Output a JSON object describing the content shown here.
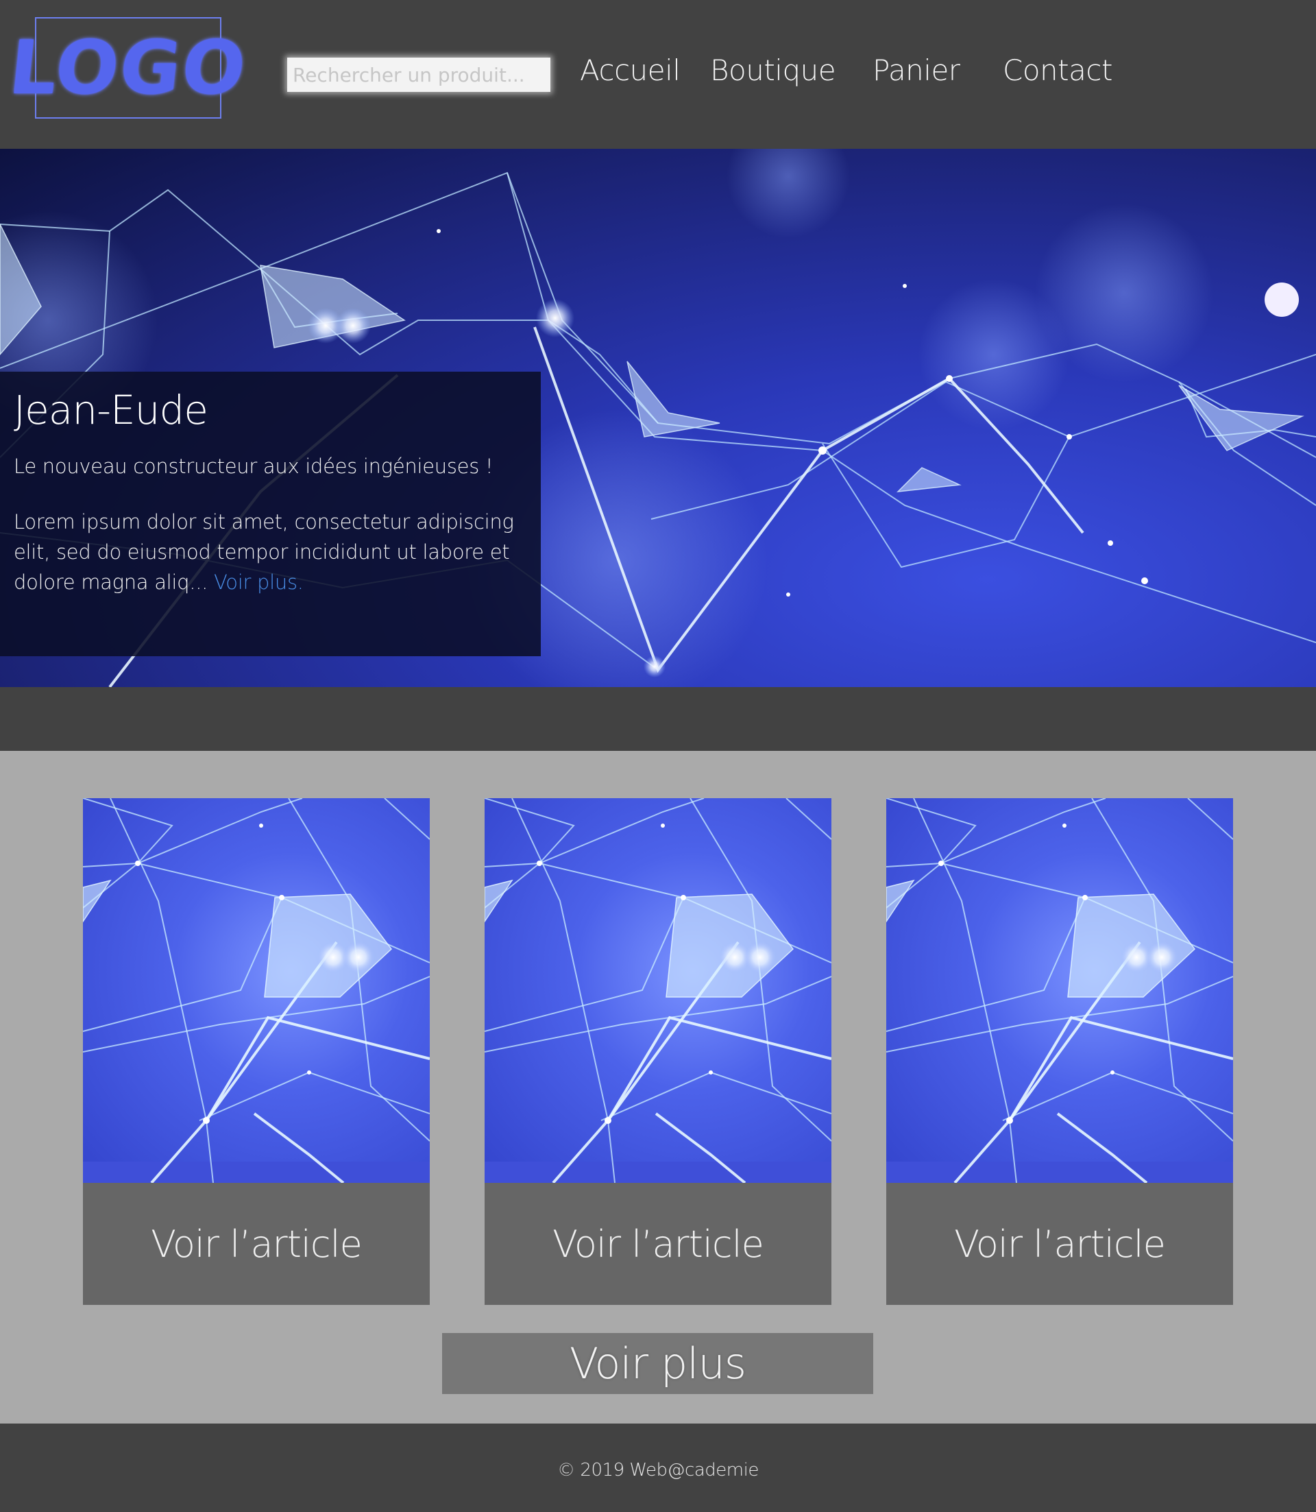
{
  "header": {
    "logo_text": "LOGO",
    "search_placeholder": "Rechercher un produit...",
    "nav": [
      "Accueil",
      "Boutique",
      "Panier",
      "Contact"
    ]
  },
  "hero": {
    "title": "Jean-Eude",
    "subtitle": "Le nouveau constructeur aux idées ingénieuses !",
    "body": "Lorem ipsum dolor sit amet, consectetur adipiscing elit, sed do eiusmod tempor incididunt ut labore et dolore magna aliq... ",
    "link": "Voir plus."
  },
  "articles": {
    "items": [
      {
        "button": "Voir l’article",
        "image": "network-image"
      },
      {
        "button": "Voir l’article",
        "image": "network-image"
      },
      {
        "button": "Voir l’article",
        "image": "network-image"
      }
    ],
    "more_button": "Voir plus"
  },
  "footer": {
    "copyright": "© 2019 Web@cademie"
  },
  "colors": {
    "header_bg": "#424242",
    "articles_bg": "#aaaaaa",
    "card_button_bg": "#666666",
    "more_button_bg": "#777777",
    "link": "#4a8fe8",
    "logo": "#5566ee"
  }
}
